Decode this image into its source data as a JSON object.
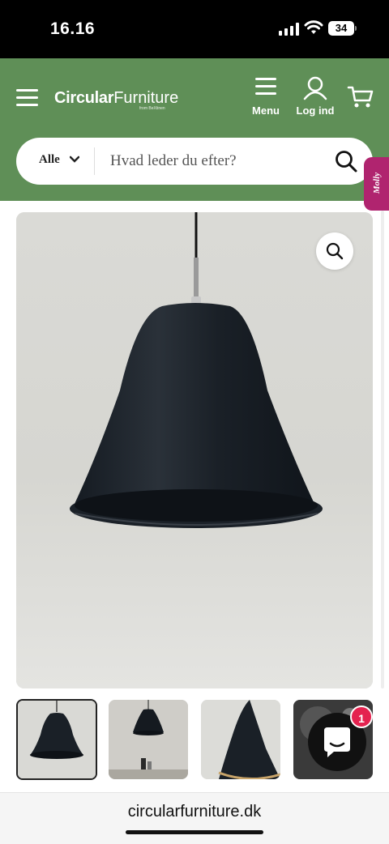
{
  "status_bar": {
    "time": "16.16",
    "battery": "34",
    "icons": [
      "signal-icon",
      "wifi-icon",
      "battery-icon"
    ]
  },
  "header": {
    "logo_bold": "Circular",
    "logo_light": "Furniture",
    "logo_tagline": "from BeXtinen",
    "menu_label": "Menu",
    "login_label": "Log ind",
    "icons": [
      "hamburger-icon",
      "menu-icon",
      "user-icon",
      "cart-icon"
    ],
    "background_color": "#5f8f57"
  },
  "search": {
    "category": "Alle",
    "placeholder": "Hvad leder du efter?"
  },
  "side_widget": {
    "label": "Molly",
    "color": "#b0246f"
  },
  "product_gallery": {
    "main_image": "black-pendant-lamp",
    "thumbnails": [
      {
        "name": "black-pendant-lamp",
        "active": true
      },
      {
        "name": "pendant-lamp-in-room",
        "active": false
      },
      {
        "name": "pendant-lamp-closeup",
        "active": false
      },
      {
        "name": "pendant-lamp-interior",
        "active": false
      }
    ]
  },
  "chat": {
    "badge_count": "1",
    "badge_color": "#e4224f"
  },
  "browser": {
    "url": "circularfurniture.dk"
  }
}
